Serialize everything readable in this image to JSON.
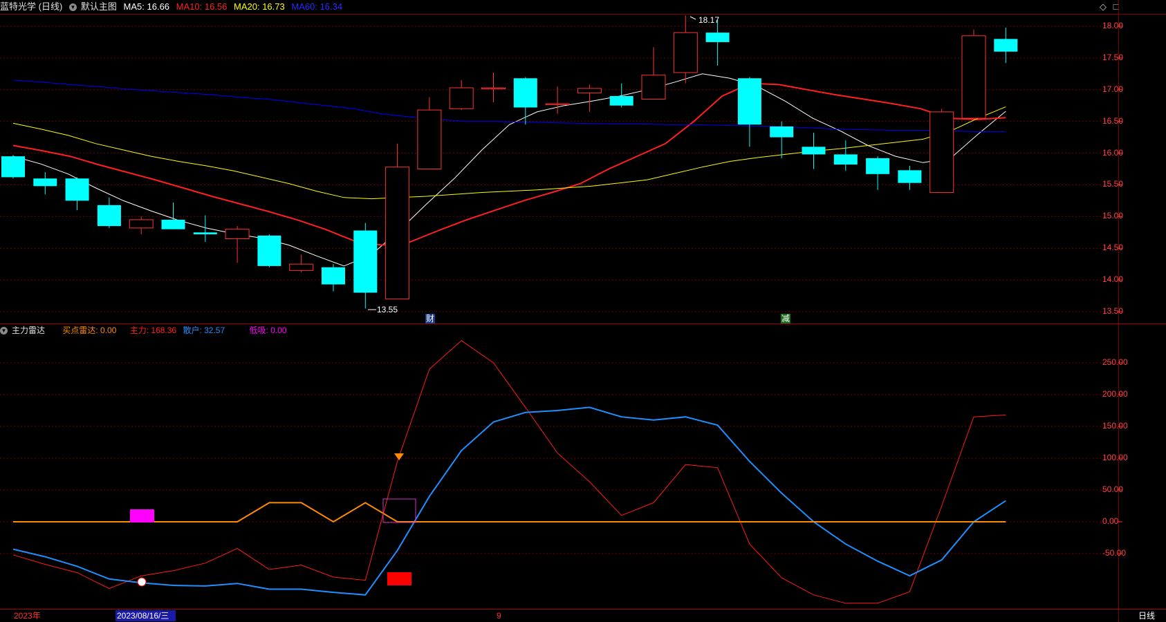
{
  "main": {
    "stock_name": "蓝特光学 (日线)",
    "template_label": "默认主图",
    "ma5": "MA5: 16.66",
    "ma10": "MA10: 16.56",
    "ma20": "MA20: 16.73",
    "ma60": "MA60: 16.34",
    "high_marker": "18.17",
    "low_marker": "13.55",
    "badge_cai": "财",
    "badge_jian": "减",
    "y_ticks": [
      "18.00",
      "17.50",
      "17.00",
      "16.50",
      "16.00",
      "15.50",
      "15.00",
      "14.50",
      "14.00",
      "13.50"
    ],
    "window_icons": [
      "◇",
      "□"
    ]
  },
  "indicator": {
    "name": "主力雷达",
    "buy_radar": "买点雷达: 0.00",
    "main_force": "主力: 168.36",
    "retail": "散户: 32.57",
    "low_absorb": "低吸: 0.00",
    "y_ticks": [
      "250.00",
      "200.00",
      "150.00",
      "100.00",
      "50.00",
      "0.00",
      "-50.00"
    ]
  },
  "bottom": {
    "year_label": "2023年",
    "date_cursor": "2023/08/16/三",
    "month_label": "9",
    "period": "日线"
  },
  "colors": {
    "up": "#ff3232",
    "down": "#00ffff",
    "ma5": "#ffffff",
    "ma10": "#ff2020",
    "ma20": "#ffff00",
    "ma60": "#0000ff",
    "main_force": "#ff1a1a",
    "retail": "#1e90ff",
    "buy_radar": "#ff8c00",
    "low_absorb": "#ff00ff",
    "grid": "#7a0000"
  },
  "chart_data": [
    {
      "type": "candlestick",
      "title": "蓝特光学 (日线)",
      "ylim": [
        13.3,
        18.2
      ],
      "candles": [
        {
          "o": 15.95,
          "h": 15.97,
          "l": 15.6,
          "c": 15.62
        },
        {
          "o": 15.6,
          "h": 15.7,
          "l": 15.35,
          "c": 15.48
        },
        {
          "o": 15.6,
          "h": 15.62,
          "l": 15.1,
          "c": 15.25
        },
        {
          "o": 15.18,
          "h": 15.3,
          "l": 14.82,
          "c": 14.85
        },
        {
          "o": 14.82,
          "h": 15.0,
          "l": 14.72,
          "c": 14.95
        },
        {
          "o": 14.95,
          "h": 15.22,
          "l": 14.8,
          "c": 14.8
        },
        {
          "o": 14.75,
          "h": 15.02,
          "l": 14.6,
          "c": 14.72
        },
        {
          "o": 14.65,
          "h": 14.85,
          "l": 14.27,
          "c": 14.8
        },
        {
          "o": 14.7,
          "h": 14.72,
          "l": 14.2,
          "c": 14.22
        },
        {
          "o": 14.15,
          "h": 14.4,
          "l": 14.12,
          "c": 14.25
        },
        {
          "o": 14.2,
          "h": 14.25,
          "l": 13.82,
          "c": 13.93
        },
        {
          "o": 14.78,
          "h": 14.9,
          "l": 13.55,
          "c": 13.8
        },
        {
          "o": 13.7,
          "h": 16.15,
          "l": 13.7,
          "c": 15.78
        },
        {
          "o": 15.75,
          "h": 16.88,
          "l": 15.75,
          "c": 16.68
        },
        {
          "o": 16.7,
          "h": 17.15,
          "l": 16.68,
          "c": 17.03
        },
        {
          "o": 17.03,
          "h": 17.27,
          "l": 16.8,
          "c": 17.03
        },
        {
          "o": 17.18,
          "h": 17.2,
          "l": 16.45,
          "c": 16.72
        },
        {
          "o": 16.78,
          "h": 17.05,
          "l": 16.62,
          "c": 16.78
        },
        {
          "o": 16.95,
          "h": 17.08,
          "l": 16.65,
          "c": 17.02
        },
        {
          "o": 16.9,
          "h": 17.1,
          "l": 16.72,
          "c": 16.75
        },
        {
          "o": 16.85,
          "h": 17.67,
          "l": 16.85,
          "c": 17.23
        },
        {
          "o": 17.27,
          "h": 18.17,
          "l": 17.1,
          "c": 17.9
        },
        {
          "o": 17.9,
          "h": 18.1,
          "l": 17.38,
          "c": 17.75
        },
        {
          "o": 17.18,
          "h": 17.2,
          "l": 16.1,
          "c": 16.45
        },
        {
          "o": 16.42,
          "h": 16.5,
          "l": 15.92,
          "c": 16.25
        },
        {
          "o": 16.1,
          "h": 16.32,
          "l": 15.75,
          "c": 15.98
        },
        {
          "o": 15.98,
          "h": 16.2,
          "l": 15.72,
          "c": 15.82
        },
        {
          "o": 15.92,
          "h": 15.95,
          "l": 15.42,
          "c": 15.67
        },
        {
          "o": 15.73,
          "h": 15.8,
          "l": 15.42,
          "c": 15.53
        },
        {
          "o": 15.38,
          "h": 16.7,
          "l": 15.38,
          "c": 16.65
        },
        {
          "o": 16.55,
          "h": 17.95,
          "l": 16.55,
          "c": 17.85
        },
        {
          "o": 17.8,
          "h": 17.98,
          "l": 17.42,
          "c": 17.6
        }
      ],
      "series": [
        {
          "name": "MA5",
          "values": [
            15.95,
            15.83,
            15.67,
            15.45,
            15.25,
            15.09,
            14.94,
            14.82,
            14.73,
            14.66,
            14.55,
            14.38,
            14.22,
            14.4,
            14.78,
            15.2,
            15.6,
            16.05,
            16.45,
            16.65,
            16.75,
            16.82,
            16.9,
            17.0,
            17.12,
            17.25,
            17.18,
            17.05,
            16.82,
            16.55,
            16.35,
            16.12,
            15.95,
            15.85,
            15.92,
            16.3,
            16.66
          ]
        },
        {
          "name": "MA10",
          "values": [
            16.12,
            16.04,
            15.95,
            15.82,
            15.7,
            15.58,
            15.45,
            15.32,
            15.2,
            15.08,
            14.95,
            14.8,
            14.62,
            14.55,
            14.6,
            14.78,
            14.95,
            15.1,
            15.25,
            15.38,
            15.52,
            15.75,
            15.95,
            16.15,
            16.5,
            16.9,
            17.1,
            17.08,
            17.0,
            16.92,
            16.85,
            16.78,
            16.7,
            16.55,
            16.53,
            16.56
          ]
        },
        {
          "name": "MA20",
          "values": [
            16.47,
            16.38,
            16.28,
            16.15,
            16.05,
            15.95,
            15.87,
            15.8,
            15.72,
            15.62,
            15.52,
            15.4,
            15.3,
            15.28,
            15.3,
            15.32,
            15.35,
            15.38,
            15.4,
            15.42,
            15.45,
            15.48,
            15.53,
            15.58,
            15.68,
            15.78,
            15.87,
            15.93,
            15.98,
            16.03,
            16.07,
            16.12,
            16.17,
            16.22,
            16.35,
            16.55,
            16.73
          ]
        },
        {
          "name": "MA60",
          "values": [
            17.15,
            17.12,
            17.08,
            17.05,
            17.01,
            16.98,
            16.95,
            16.92,
            16.88,
            16.85,
            16.8,
            16.75,
            16.7,
            16.62,
            16.57,
            16.53,
            16.5,
            16.5,
            16.49,
            16.48,
            16.47,
            16.46,
            16.46,
            16.45,
            16.45,
            16.44,
            16.43,
            16.42,
            16.4,
            16.38,
            16.37,
            16.36,
            16.36,
            16.35,
            16.34,
            16.34
          ]
        }
      ]
    },
    {
      "type": "line",
      "title": "主力雷达",
      "ylim": [
        -130,
        290
      ],
      "series": [
        {
          "name": "主力",
          "values": [
            -52,
            -67,
            -80,
            -105,
            -85,
            -77,
            -65,
            -42,
            -75,
            -68,
            -87,
            -92,
            95,
            240,
            285,
            250,
            180,
            108,
            63,
            10,
            30,
            90,
            85,
            -35,
            -88,
            -115,
            -128,
            -128,
            -110,
            25,
            165,
            168
          ]
        },
        {
          "name": "散户",
          "values": [
            -43,
            -55,
            -70,
            -90,
            -96,
            -100,
            -101,
            -97,
            -106,
            -106,
            -111,
            -115,
            -45,
            40,
            112,
            157,
            172,
            175,
            180,
            165,
            160,
            165,
            152,
            95,
            45,
            0,
            -35,
            -62,
            -85,
            -60,
            0,
            33
          ]
        },
        {
          "name": "买点雷达",
          "values": [
            0,
            0,
            0,
            0,
            0,
            0,
            0,
            0,
            30,
            30,
            0,
            30,
            0,
            0,
            0,
            0,
            0,
            0,
            0,
            0,
            0,
            0,
            0,
            0,
            0,
            0,
            0,
            0,
            0,
            0,
            0,
            0
          ]
        },
        {
          "name": "低吸",
          "values": [
            0
          ]
        }
      ]
    }
  ]
}
